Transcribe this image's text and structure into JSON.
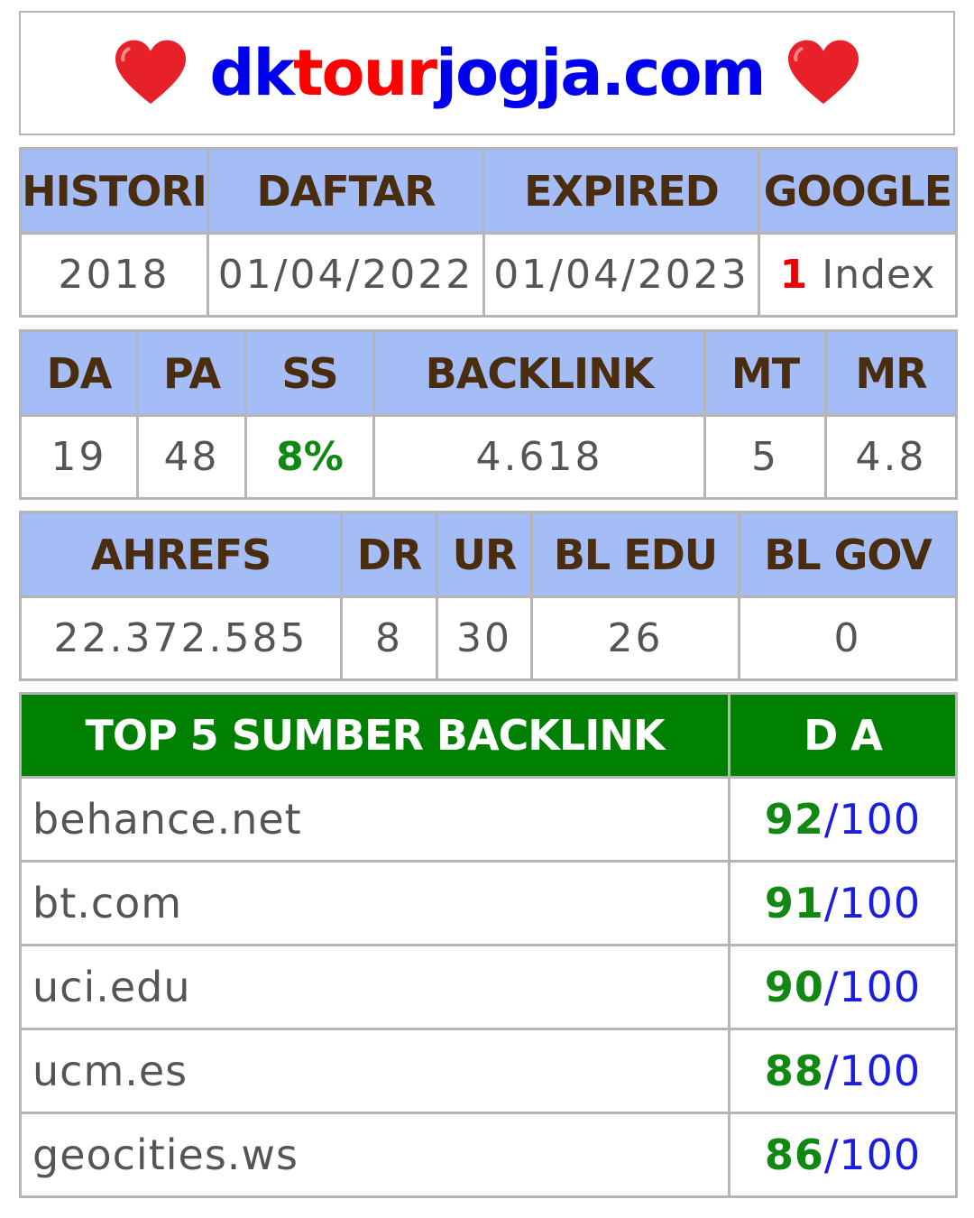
{
  "header": {
    "left_emoji": "heart-icon",
    "domain_part1": "dk",
    "domain_part2": "tour",
    "domain_part3": "jogja.com",
    "right_emoji": "heart-icon"
  },
  "table1": {
    "headers": [
      "HISTORI",
      "DAFTAR",
      "EXPIRED",
      "GOOGLE"
    ],
    "histori": "2018",
    "daftar": "01/04/2022",
    "expired": "01/04/2023",
    "google_count": "1",
    "google_label": "Index"
  },
  "table2": {
    "headers": [
      "DA",
      "PA",
      "SS",
      "BACKLINK",
      "MT",
      "MR"
    ],
    "values": [
      "19",
      "48",
      "8%",
      "4.618",
      "5",
      "4.8"
    ]
  },
  "table3": {
    "headers": [
      "AHREFS",
      "DR",
      "UR",
      "BL EDU",
      "BL GOV"
    ],
    "values": [
      "22.372.585",
      "8",
      "30",
      "26",
      "0"
    ]
  },
  "top_sources": {
    "header_source": "TOP 5 SUMBER BACKLINK",
    "header_da": "D A",
    "max": "/100",
    "rows": [
      {
        "site": "behance.net",
        "da": "92"
      },
      {
        "site": "bt.com",
        "da": "91"
      },
      {
        "site": "uci.edu",
        "da": "90"
      },
      {
        "site": "ucm.es",
        "da": "88"
      },
      {
        "site": "geocities.ws",
        "da": "86"
      }
    ]
  },
  "colors": {
    "header_bg": "#a4bdf7",
    "header_text": "#4a2c0e",
    "green_header": "#008000",
    "domain_blue": "#0000ee",
    "domain_red": "#ff0000"
  }
}
